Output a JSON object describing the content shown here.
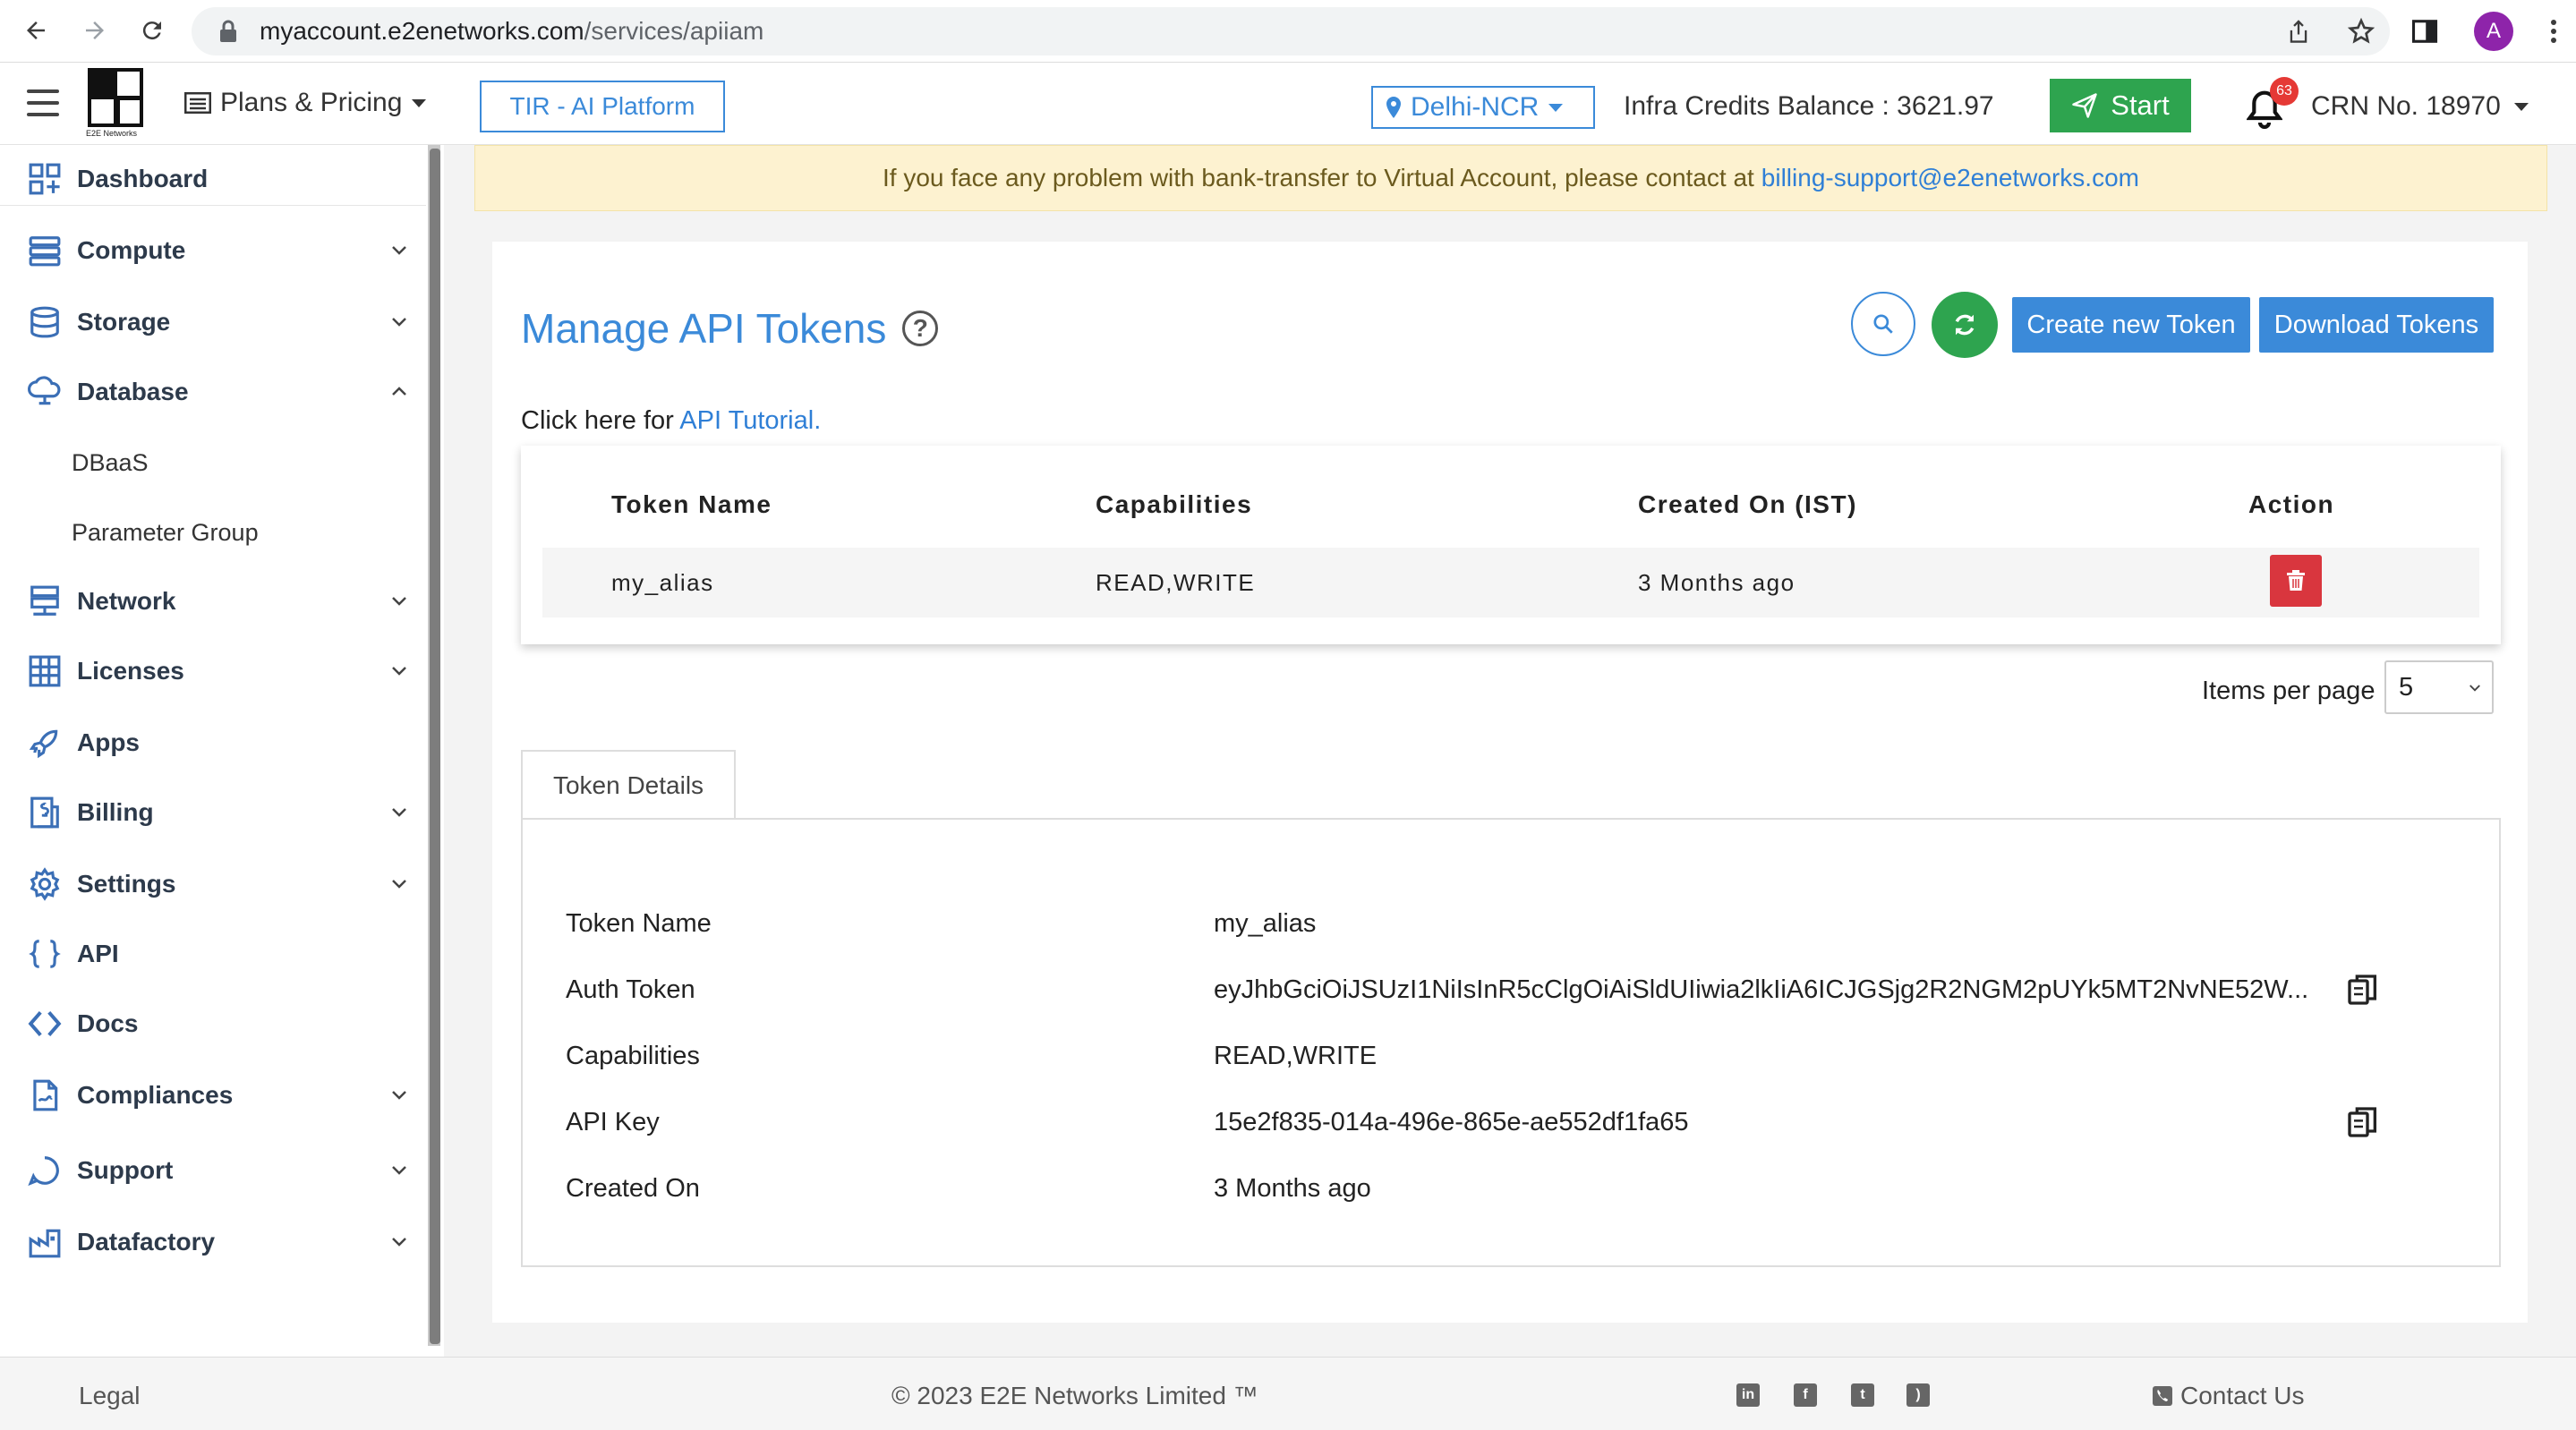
{
  "browser": {
    "url_host": "myaccount.e2enetworks.com",
    "url_path": "/services/apiiam",
    "profile_initial": "A"
  },
  "header": {
    "logo_text": "E2E Networks",
    "plans_label": "Plans & Pricing",
    "tir_label": "TIR - AI Platform",
    "region_label": "Delhi-NCR",
    "credits_label": "Infra Credits Balance : 3621.97",
    "start_label": "Start",
    "notification_count": "63",
    "crn_label": "CRN No. 18970"
  },
  "sidebar": {
    "items": [
      {
        "label": "Dashboard",
        "icon": "dashboard-icon"
      },
      {
        "label": "Compute",
        "icon": "compute-icon"
      },
      {
        "label": "Storage",
        "icon": "storage-icon"
      },
      {
        "label": "Database",
        "icon": "database-icon"
      },
      {
        "label": "Network",
        "icon": "network-icon"
      },
      {
        "label": "Licenses",
        "icon": "licenses-icon"
      },
      {
        "label": "Apps",
        "icon": "apps-icon"
      },
      {
        "label": "Billing",
        "icon": "billing-icon"
      },
      {
        "label": "Settings",
        "icon": "gear-icon"
      },
      {
        "label": "API",
        "icon": "braces-icon"
      },
      {
        "label": "Docs",
        "icon": "code-icon"
      },
      {
        "label": "Compliances",
        "icon": "document-icon"
      },
      {
        "label": "Support",
        "icon": "support-icon"
      },
      {
        "label": "Datafactory",
        "icon": "datafactory-icon"
      }
    ],
    "database_subitems": [
      "DBaaS",
      "Parameter Group"
    ]
  },
  "alert": {
    "text": "If you face any problem with bank-transfer to Virtual Account, please contact at",
    "email": "billing-support@e2enetworks.com"
  },
  "page": {
    "title": "Manage API Tokens",
    "create_label": "Create new Token",
    "download_label": "Download Tokens",
    "tutorial_prefix": "Click here for",
    "tutorial_link": "API Tutorial."
  },
  "table": {
    "headers": [
      "Token Name",
      "Capabilities",
      "Created On (IST)",
      "Action"
    ],
    "rows": [
      {
        "name": "my_alias",
        "capabilities": "READ,WRITE",
        "created": "3 Months ago"
      }
    ]
  },
  "pagination": {
    "label": "Items per page",
    "value": "5"
  },
  "details": {
    "tab_label": "Token Details",
    "rows": [
      {
        "label": "Token Name",
        "value": "my_alias"
      },
      {
        "label": "Auth Token",
        "value": "eyJhbGciOiJSUzI1NiIsInR5cClgOiAiSldUIiwia2lkIiA6ICJGSjg2R2NGM2pUYk5MT2NvNE52W..."
      },
      {
        "label": "Capabilities",
        "value": "READ,WRITE"
      },
      {
        "label": "API Key",
        "value": "15e2f835-014a-496e-865e-ae552df1fa65"
      },
      {
        "label": "Created On",
        "value": "3 Months ago"
      }
    ]
  },
  "footer": {
    "legal": "Legal",
    "copyright": "© 2023 E2E Networks Limited ™",
    "contact": "Contact Us"
  },
  "colors": {
    "accent": "#3b8ad9",
    "success": "#2ea44f",
    "danger": "#d9363e",
    "alert_bg": "#fdf2d0"
  }
}
